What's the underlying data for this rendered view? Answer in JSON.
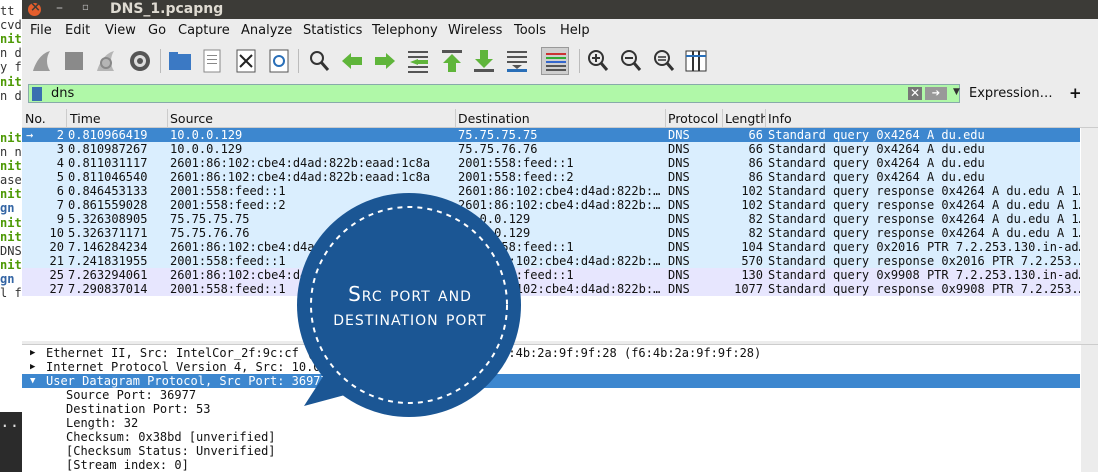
{
  "terminal": {
    "lines": [
      {
        "text": "tt",
        "cls": ""
      },
      {
        "text": "cvd",
        "cls": ""
      },
      {
        "text": "nit",
        "cls": "g"
      },
      {
        "text": "n d",
        "cls": ""
      },
      {
        "text": "y f",
        "cls": ""
      },
      {
        "text": "nit",
        "cls": "g"
      },
      {
        "text": "n d",
        "cls": ""
      },
      {
        "text": "",
        "cls": ""
      },
      {
        "text": "",
        "cls": ""
      },
      {
        "text": "nit",
        "cls": "g"
      },
      {
        "text": "n n",
        "cls": ""
      },
      {
        "text": "nit",
        "cls": "g"
      },
      {
        "text": "ase",
        "cls": ""
      },
      {
        "text": "nit",
        "cls": "g"
      },
      {
        "text": "gn",
        "cls": "b"
      },
      {
        "text": "nit",
        "cls": "g"
      },
      {
        "text": "nit",
        "cls": "g"
      },
      {
        "text": "DNS",
        "cls": ""
      },
      {
        "text": "nit",
        "cls": "g"
      },
      {
        "text": "gn",
        "cls": "b"
      },
      {
        "text": "l f",
        "cls": ""
      }
    ],
    "prompt": ".."
  },
  "window": {
    "title": "DNS_1.pcapng",
    "min_glyph": "–",
    "max_glyph": "▫"
  },
  "menu": [
    "File",
    "Edit",
    "View",
    "Go",
    "Capture",
    "Analyze",
    "Statistics",
    "Telephony",
    "Wireless",
    "Tools",
    "Help"
  ],
  "toolbar_icons": [
    "shark-fin-start-icon",
    "stop-icon",
    "restart-icon",
    "options-gear-icon",
    "open-folder-icon",
    "file-set-icon",
    "close-file-icon",
    "reload-icon",
    "find-icon",
    "back-arrow-icon",
    "forward-arrow-icon",
    "go-to-packet-icon",
    "first-packet-icon",
    "last-packet-icon",
    "autoscroll-icon",
    "colorize-icon",
    "zoom-in-icon",
    "zoom-out-icon",
    "normal-size-icon",
    "resize-columns-icon"
  ],
  "filter": {
    "value": "dns",
    "clear_glyph": "✕",
    "apply_glyph": "➔",
    "dropdown_glyph": "▼",
    "expression_label": "Expression…",
    "add_label": "+"
  },
  "columns": [
    "No.",
    "Time",
    "Source",
    "Destination",
    "Protocol",
    "Length",
    "Info"
  ],
  "packets": [
    {
      "no": "2",
      "time": "0.810966419",
      "src": "10.0.0.129",
      "dst": "75.75.75.75",
      "proto": "DNS",
      "len": "66",
      "info": "Standard query 0x4264 A du.edu",
      "style": "selected",
      "mark": "→"
    },
    {
      "no": "3",
      "time": "0.810987267",
      "src": "10.0.0.129",
      "dst": "75.75.76.76",
      "proto": "DNS",
      "len": "66",
      "info": "Standard query 0x4264 A du.edu",
      "style": "blue",
      "mark": ""
    },
    {
      "no": "4",
      "time": "0.811031117",
      "src": "2601:86:102:cbe4:d4ad:822b:eaad:1c8a",
      "dst": "2001:558:feed::1",
      "proto": "DNS",
      "len": "86",
      "info": "Standard query 0x4264 A du.edu",
      "style": "blue",
      "mark": ""
    },
    {
      "no": "5",
      "time": "0.811046540",
      "src": "2601:86:102:cbe4:d4ad:822b:eaad:1c8a",
      "dst": "2001:558:feed::2",
      "proto": "DNS",
      "len": "86",
      "info": "Standard query 0x4264 A du.edu",
      "style": "blue",
      "mark": ""
    },
    {
      "no": "6",
      "time": "0.846453133",
      "src": "2001:558:feed::1",
      "dst": "2601:86:102:cbe4:d4ad:822b:…",
      "proto": "DNS",
      "len": "102",
      "info": "Standard query response 0x4264 A du.edu A 1…",
      "style": "blue",
      "mark": ""
    },
    {
      "no": "7",
      "time": "0.861559028",
      "src": "2001:558:feed::2",
      "dst": "2601:86:102:cbe4:d4ad:822b:…",
      "proto": "DNS",
      "len": "102",
      "info": "Standard query response 0x4264 A du.edu A 1…",
      "style": "blue",
      "mark": ""
    },
    {
      "no": "9",
      "time": "5.326308905",
      "src": "75.75.75.75",
      "dst": "10.0.0.129",
      "proto": "DNS",
      "len": "82",
      "info": "Standard query response 0x4264 A du.edu A 1…",
      "style": "blue",
      "mark": ""
    },
    {
      "no": "10",
      "time": "5.326371171",
      "src": "75.75.76.76",
      "dst": "10.0.0.129",
      "proto": "DNS",
      "len": "82",
      "info": "Standard query response 0x4264 A du.edu A 1…",
      "style": "blue",
      "mark": ""
    },
    {
      "no": "20",
      "time": "7.146284234",
      "src": "2601:86:102:cbe4:d4ad:822b:eaad:1c8a",
      "dst": "2001:558:feed::1",
      "proto": "DNS",
      "len": "104",
      "info": "Standard query 0x2016 PTR 7.2.253.130.in-ad…",
      "style": "blue",
      "mark": ""
    },
    {
      "no": "21",
      "time": "7.241831955",
      "src": "2001:558:feed::1",
      "dst": "2601:86:102:cbe4:d4ad:822b:…",
      "proto": "DNS",
      "len": "570",
      "info": "Standard query response 0x2016 PTR 7.2.253.…",
      "style": "blue",
      "mark": ""
    },
    {
      "no": "25",
      "time": "7.263294061",
      "src": "2601:86:102:cbe4:d4ad:822b:eaad:1c8a",
      "dst": "2001:558:feed::1",
      "proto": "DNS",
      "len": "130",
      "info": "Standard query 0x9908 PTR 7.2.253.130.in-ad…",
      "style": "lavender",
      "mark": ""
    },
    {
      "no": "27",
      "time": "7.290837014",
      "src": "2001:558:feed::1",
      "dst": "2601:86:102:cbe4:d4ad:822b:…",
      "proto": "DNS",
      "len": "1077",
      "info": "Standard query response 0x9908 PTR 7.2.253.…",
      "style": "lavender",
      "mark": ""
    }
  ],
  "details": [
    {
      "arrow": "▶",
      "text": "Ethernet II, Src: IntelCor_2f:9c:cf (00:00:00:2f:9c:cf), Dst: f6:4b:2a:9f:9f:28 (f6:4b:2a:9f:9f:28)",
      "indent": 0,
      "selected": false
    },
    {
      "arrow": "▶",
      "text": "Internet Protocol Version 4, Src: 10.0.0.129, Dst: 75.75.75.75",
      "indent": 0,
      "selected": false
    },
    {
      "arrow": "▼",
      "text": "User Datagram Protocol, Src Port: 36977, Dst Port: 53",
      "indent": 0,
      "selected": true
    },
    {
      "arrow": "",
      "text": "Source Port: 36977",
      "indent": 1,
      "selected": false
    },
    {
      "arrow": "",
      "text": "Destination Port: 53",
      "indent": 1,
      "selected": false
    },
    {
      "arrow": "",
      "text": "Length: 32",
      "indent": 1,
      "selected": false
    },
    {
      "arrow": "",
      "text": "Checksum: 0x38bd [unverified]",
      "indent": 1,
      "selected": false
    },
    {
      "arrow": "",
      "text": "[Checksum Status: Unverified]",
      "indent": 1,
      "selected": false
    },
    {
      "arrow": "",
      "text": "[Stream index: 0]",
      "indent": 1,
      "selected": false
    }
  ],
  "annotation": {
    "line1": "Src port and",
    "line2": "destination port",
    "color": "#1b5694"
  },
  "colors": {
    "selected_row": "#3d87cf",
    "blue_row": "#daeefe",
    "lavender_row": "#e7e6fe",
    "filter_valid": "#b0f8a8",
    "detail_selected": "#3d87cf"
  }
}
